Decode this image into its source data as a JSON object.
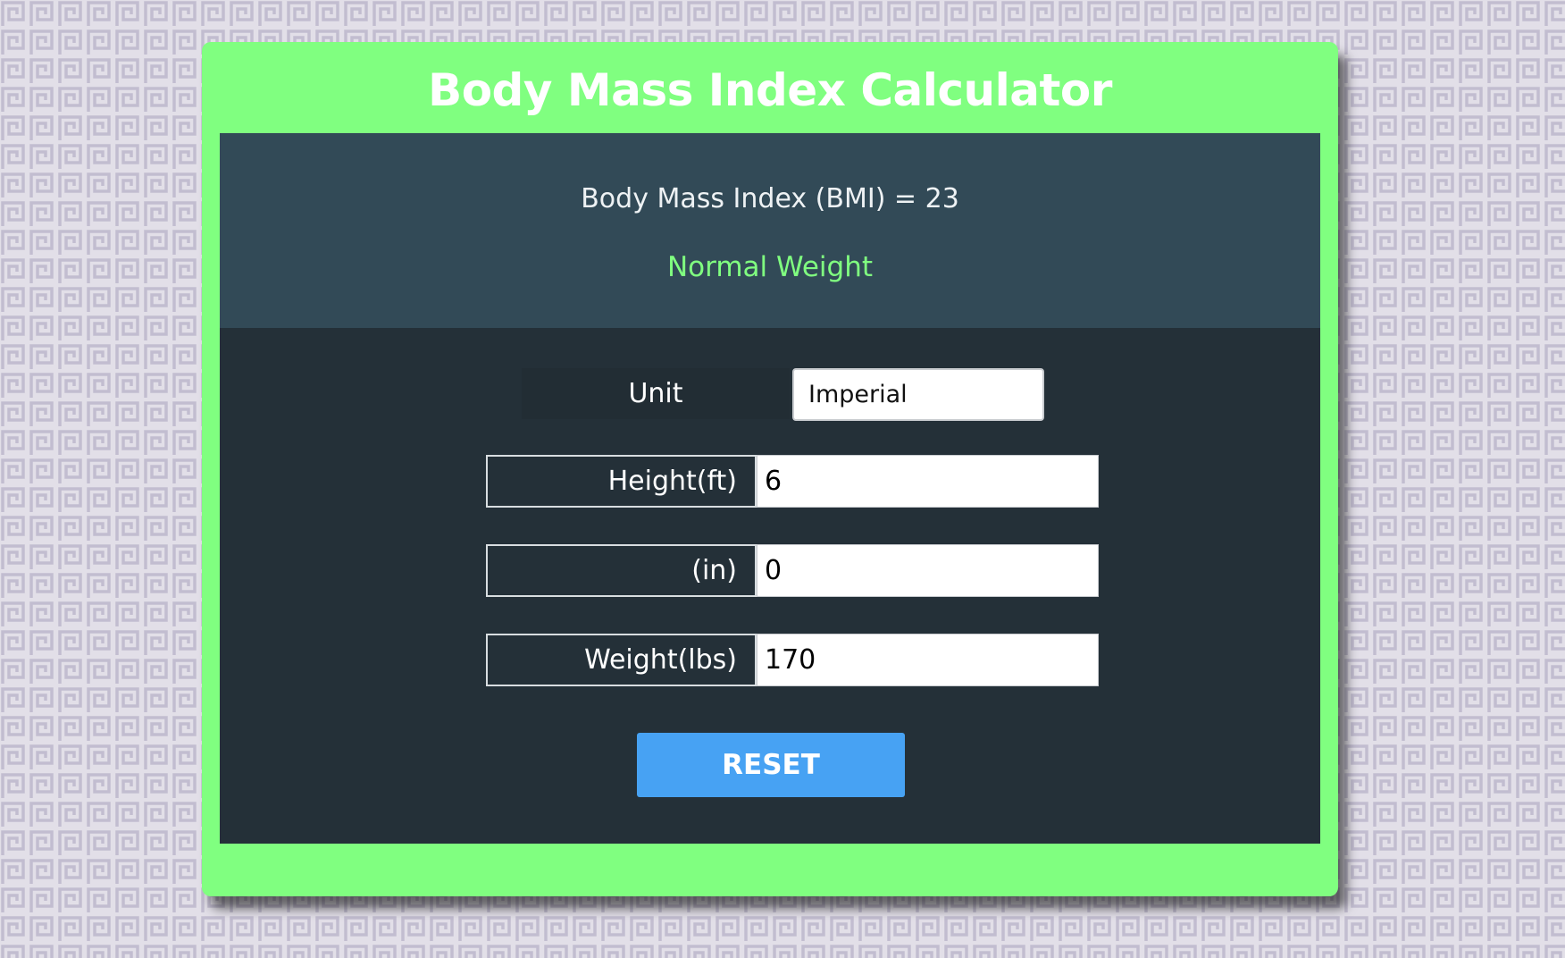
{
  "title": "Body Mass Index Calculator",
  "result": {
    "bmi_text": "Body Mass Index (BMI) = 23",
    "status": "Normal Weight"
  },
  "form": {
    "unit_label": "Unit",
    "unit_value": "Imperial",
    "height_ft_label": "Height(ft)",
    "height_ft_value": "6",
    "height_in_label": "(in)",
    "height_in_value": "0",
    "weight_label": "Weight(lbs)",
    "weight_value": "170",
    "reset_label": "RESET"
  },
  "colors": {
    "card_background": "#80ff80",
    "result_panel": "#324a57",
    "form_panel": "#243038",
    "status_text": "#80ff80",
    "reset_button": "#47a2f3",
    "background_pattern": "#c4c0d0"
  },
  "icons": {
    "background": "greek-key-pattern"
  }
}
